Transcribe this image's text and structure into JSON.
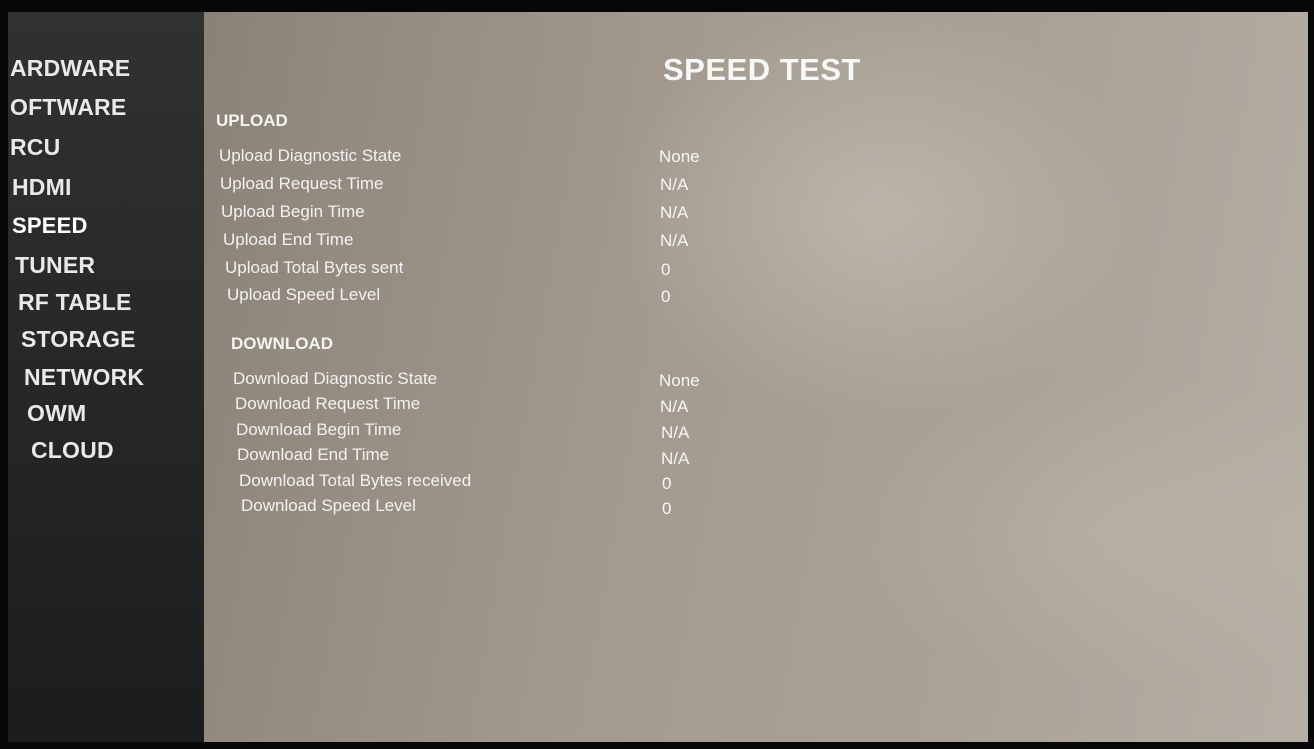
{
  "sidebar": {
    "items": [
      {
        "label": "ARDWARE"
      },
      {
        "label": "OFTWARE"
      },
      {
        "label": "RCU"
      },
      {
        "label": "HDMI"
      },
      {
        "label": "SPEED"
      },
      {
        "label": "TUNER"
      },
      {
        "label": "RF TABLE"
      },
      {
        "label": "STORAGE"
      },
      {
        "label": "NETWORK"
      },
      {
        "label": "OWM"
      },
      {
        "label": "CLOUD"
      }
    ],
    "active_item": "SPEED"
  },
  "main": {
    "title": "SPEED TEST",
    "upload": {
      "heading": "UPLOAD",
      "rows": [
        {
          "label": "Upload Diagnostic State",
          "value": "None"
        },
        {
          "label": "Upload Request Time",
          "value": "N/A"
        },
        {
          "label": "Upload Begin Time",
          "value": "N/A"
        },
        {
          "label": "Upload End Time",
          "value": "N/A"
        },
        {
          "label": "Upload Total Bytes sent",
          "value": "0"
        },
        {
          "label": "Upload Speed Level",
          "value": "0"
        }
      ]
    },
    "download": {
      "heading": "DOWNLOAD",
      "rows": [
        {
          "label": "Download Diagnostic State",
          "value": "None"
        },
        {
          "label": "Download Request Time",
          "value": "N/A"
        },
        {
          "label": "Download Begin Time",
          "value": "N/A"
        },
        {
          "label": "Download End Time",
          "value": "N/A"
        },
        {
          "label": "Download Total Bytes received",
          "value": "0"
        },
        {
          "label": "Download Speed Level",
          "value": "0"
        }
      ]
    }
  }
}
